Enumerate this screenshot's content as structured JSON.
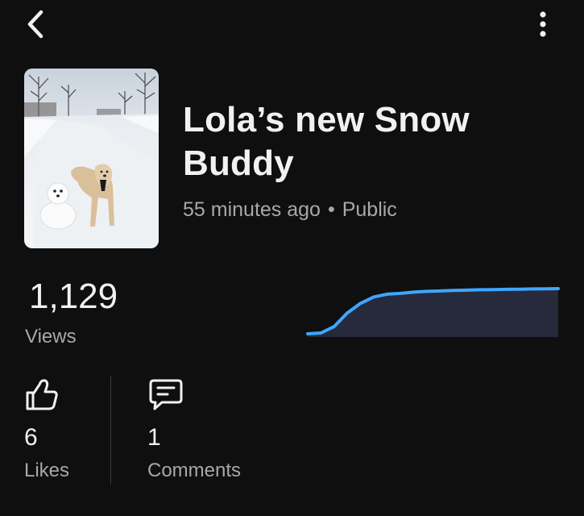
{
  "header": {
    "back_icon": "chevron-left-icon",
    "more_icon": "vertical-dots-icon"
  },
  "video": {
    "thumbnail_description": "dog-and-snowman-photo",
    "title": "Lola’s new Snow Buddy",
    "age": "55 minutes ago",
    "separator": "•",
    "visibility": "Public"
  },
  "stats": {
    "views_count": "1,129",
    "views_label": "Views",
    "likes_count": "6",
    "likes_label": "Likes",
    "likes_icon": "thumbs-up-icon",
    "comments_count": "1",
    "comments_label": "Comments",
    "comments_icon": "comment-icon"
  },
  "colors": {
    "background": "#0f0f0f",
    "chart_line": "#3ea6ff",
    "chart_fill": "#272a3a",
    "text_secondary": "#a8a8a8"
  },
  "chart_data": {
    "type": "area",
    "title": "",
    "xlabel": "",
    "ylabel": "",
    "grid": false,
    "x": [
      0,
      1,
      2,
      3,
      4,
      5,
      6,
      7,
      8,
      9,
      10,
      11,
      12,
      13,
      14,
      15,
      16,
      17,
      18,
      19
    ],
    "values": [
      0,
      20,
      180,
      520,
      760,
      920,
      990,
      1010,
      1040,
      1060,
      1070,
      1085,
      1090,
      1100,
      1105,
      1110,
      1115,
      1120,
      1125,
      1129
    ],
    "ylim": [
      0,
      1129
    ]
  }
}
